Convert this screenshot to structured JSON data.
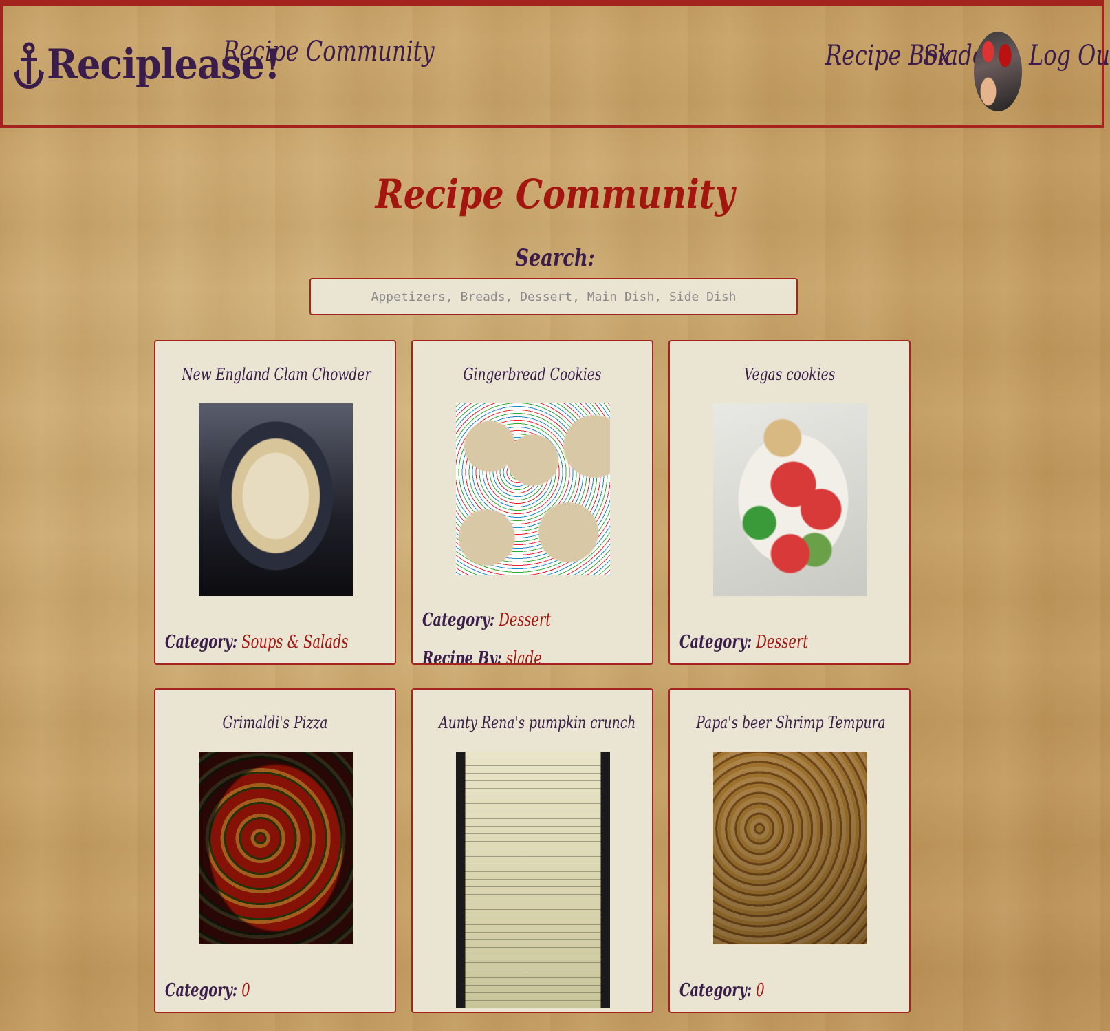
{
  "header": {
    "brand_name": "Reciplease!",
    "brand_icon": "anchor-icon",
    "nav_left": [
      {
        "label": "Recipe Community"
      }
    ],
    "nav_right": [
      {
        "label": "Recipe Box"
      },
      {
        "label": "Slade"
      },
      {
        "label": "Log Out"
      }
    ]
  },
  "page": {
    "title": "Recipe Community"
  },
  "search": {
    "label": "Search:",
    "value": "",
    "placeholder": "Appetizers, Breads, Dessert, Main Dish, Side Dish"
  },
  "recipes": [
    {
      "title": "New England Clam Chowder",
      "category_label": "Category:",
      "category": "Soups & Salads"
    },
    {
      "title": "Gingerbread Cookies",
      "category_label": "Category:",
      "category": "Dessert",
      "author_label": "Recipe By:",
      "author": "slade"
    },
    {
      "title": "Vegas cookies",
      "category_label": "Category:",
      "category": "Dessert"
    },
    {
      "title": "Grimaldi's Pizza",
      "category_label": "Category:",
      "category": "0"
    },
    {
      "title": "Aunty Rena's pumpkin crunch"
    },
    {
      "title": "Papa's beer Shrimp Tempura",
      "category_label": "Category:",
      "category": "0"
    }
  ],
  "colors": {
    "accent": "#a3231f",
    "text": "#3a1d4a",
    "card_bg": "#eae4d3"
  }
}
